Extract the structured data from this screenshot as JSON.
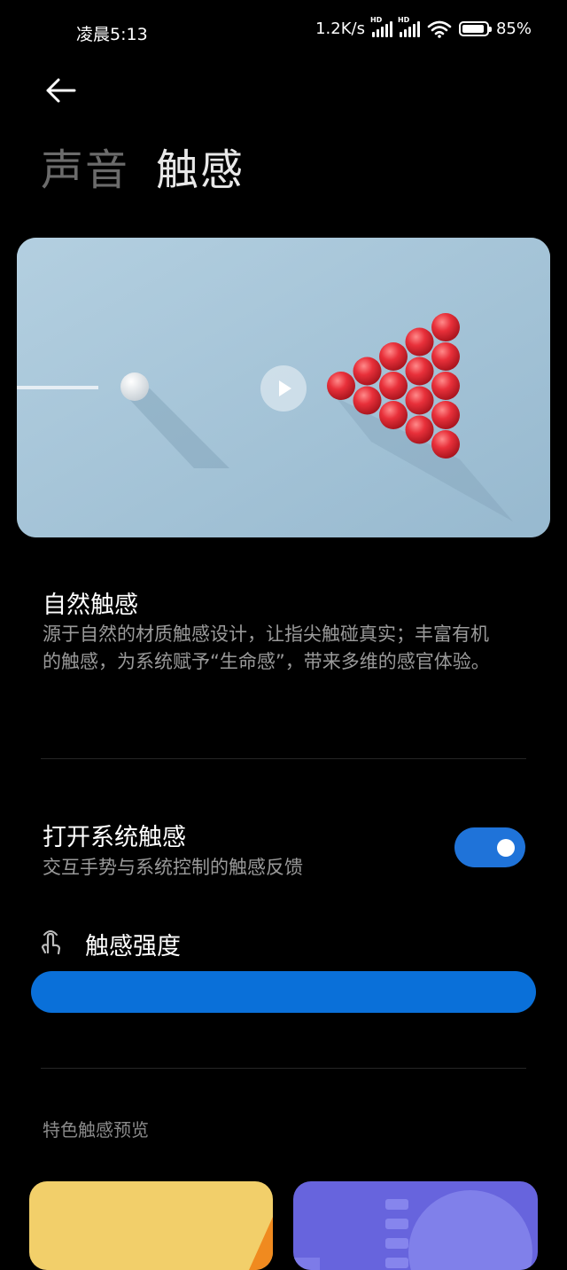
{
  "status_bar": {
    "time": "凌晨5:13",
    "net_speed": "1.2K/s",
    "signal_tag": "HD",
    "battery": "85%"
  },
  "tabs": {
    "sound": "声音",
    "haptic": "触感",
    "active": "haptic"
  },
  "hero": {
    "section_title": "自然触感",
    "description": "源于自然的材质触感设计，让指尖触碰真实；丰富有机的触感，为系统赋予“生命感”，带来多维的感官体验。"
  },
  "system_haptics": {
    "title": "打开系统触感",
    "subtitle": "交互手势与系统控制的触感反馈",
    "enabled": true
  },
  "intensity": {
    "label": "触感强度",
    "level": 1.0
  },
  "preview": {
    "label": "特色触感预览"
  },
  "colors": {
    "accent": "#1f73d9",
    "background": "#000000",
    "card_a": "#f2cf6a",
    "card_b": "#6764dd"
  }
}
